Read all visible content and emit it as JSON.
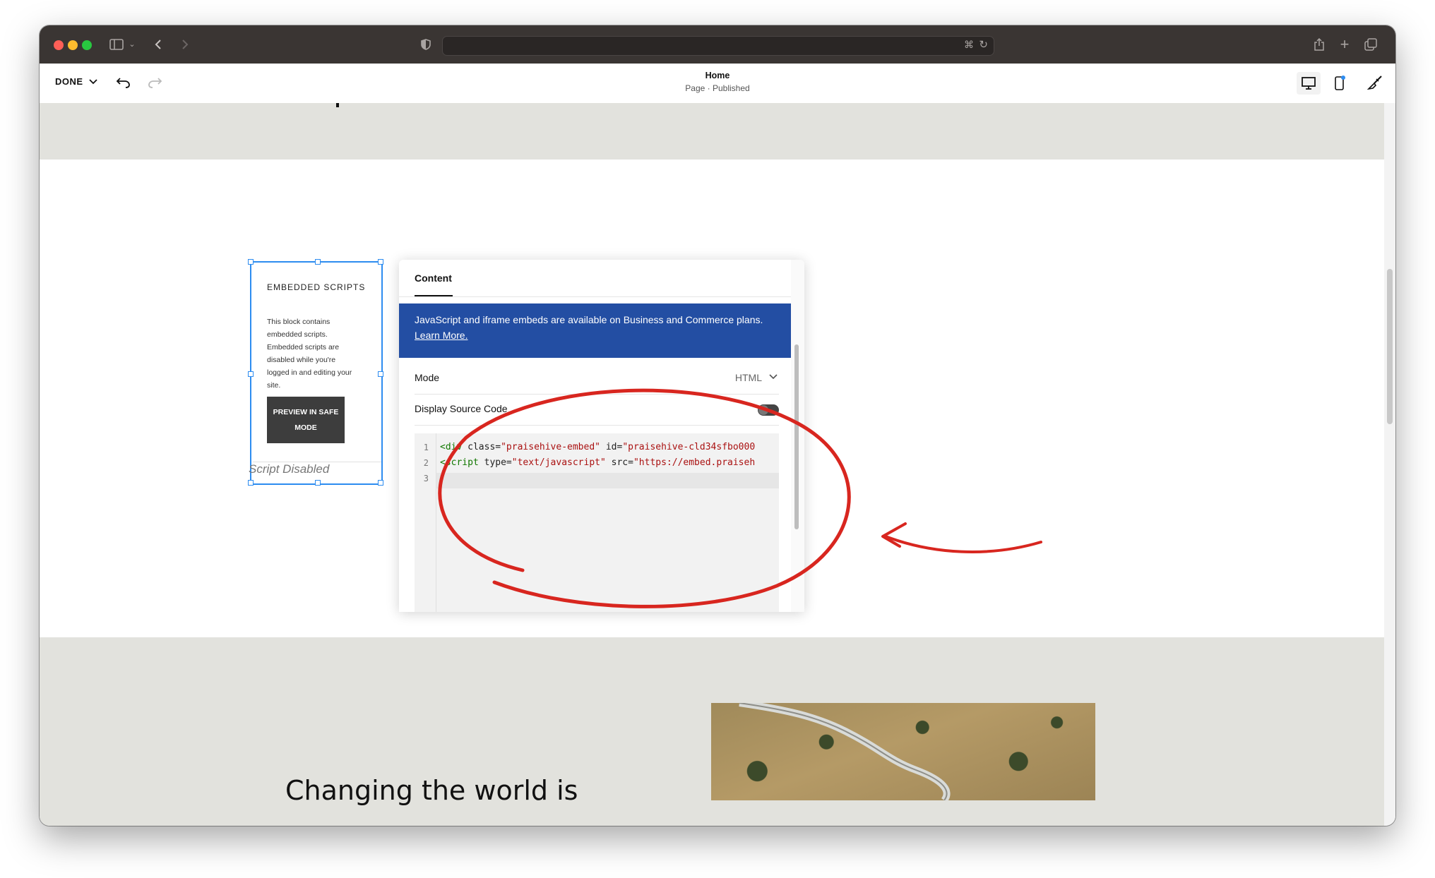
{
  "editor": {
    "done_label": "DONE",
    "page_title": "Home",
    "page_status": "Page · Published"
  },
  "embed_block": {
    "heading": "EMBEDDED SCRIPTS",
    "description": "This block contains embedded scripts. Embedded scripts are disabled while you're logged in and editing your site.",
    "preview_button": "PREVIEW IN SAFE MODE",
    "placeholder": "Script Disabled"
  },
  "panel": {
    "tab": "Content",
    "banner_text": "JavaScript and iframe embeds are available on Business and Commerce plans.",
    "banner_link": "Learn More.",
    "mode_label": "Mode",
    "mode_value": "HTML",
    "source_label": "Display Source Code",
    "source_enabled": false,
    "code_lines": [
      {
        "number": "1",
        "parts": [
          [
            "tag",
            "<div"
          ],
          [
            "plain",
            " class="
          ],
          [
            "str",
            "\"praisehive-embed\""
          ],
          [
            "plain",
            " id="
          ],
          [
            "str",
            "\"praisehive-cld34sfbo000"
          ]
        ]
      },
      {
        "number": "2",
        "parts": [
          [
            "tag",
            "<script"
          ],
          [
            "plain",
            " type="
          ],
          [
            "str",
            "\"text/javascript\""
          ],
          [
            "plain",
            " src="
          ],
          [
            "str",
            "\"https://embed.praiseh"
          ]
        ]
      },
      {
        "number": "3",
        "parts": []
      }
    ]
  },
  "section": {
    "headline": "Changing the world is"
  },
  "colors": {
    "accent_blue": "#2d8cf0",
    "banner_blue": "#234ea3",
    "annotation_red": "#d8261f",
    "section_gray": "#e2e2dd"
  },
  "icons": [
    "sidebar-icon",
    "back-icon",
    "forward-icon",
    "shield-icon",
    "translate-icon",
    "reload-icon",
    "share-icon",
    "new-tab-icon",
    "tabs-icon",
    "undo-icon",
    "redo-icon",
    "desktop-icon",
    "mobile-icon",
    "brush-icon",
    "chevron-down-icon"
  ]
}
